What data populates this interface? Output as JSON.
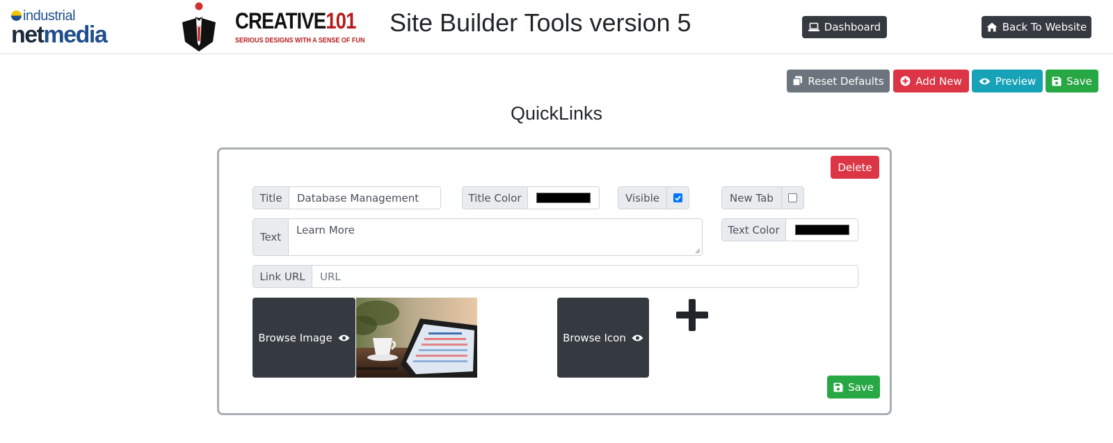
{
  "header": {
    "logo_industrial_text": "industrial",
    "logo_net_text": "net",
    "logo_media_text": "media",
    "logo_creative_text": "CREATIVE",
    "logo_creative_num": "101",
    "logo_creative_tagline": "SERIOUS DESIGNS WITH A SENSE OF FUN",
    "title": "Site Builder Tools version 5",
    "dashboard_label": "Dashboard",
    "back_label": "Back To Website"
  },
  "toolbar": {
    "reset_label": "Reset Defaults",
    "add_label": "Add New",
    "preview_label": "Preview",
    "save_label": "Save"
  },
  "page": {
    "heading": "QuickLinks"
  },
  "card": {
    "delete_label": "Delete",
    "title_label": "Title",
    "title_value": "Database Management",
    "title_color_label": "Title Color",
    "title_color_value": "#000000",
    "visible_label": "Visible",
    "visible_checked": true,
    "new_tab_label": "New Tab",
    "new_tab_checked": false,
    "text_label": "Text",
    "text_value": "Learn More",
    "text_color_label": "Text Color",
    "text_color_value": "#000000",
    "link_url_label": "Link URL",
    "link_url_value": "",
    "link_url_placeholder": "URL",
    "browse_image_label": "Browse Image",
    "browse_icon_label": "Browse Icon",
    "selected_icon": "plus-icon",
    "save_label": "Save"
  },
  "colors": {
    "dark": "#343a40",
    "secondary": "#6c757d",
    "danger": "#dc3545",
    "info": "#17a2b8",
    "success": "#28a745",
    "creative_red": "#b71c1c",
    "netmedia_blue": "#1f4e8c"
  }
}
